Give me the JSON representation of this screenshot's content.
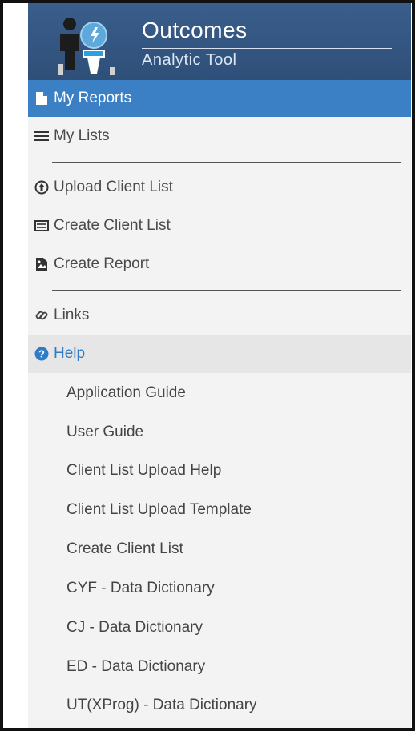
{
  "brand": {
    "title": "Outcomes",
    "subtitle": "Analytic Tool"
  },
  "nav": {
    "my_reports": "My Reports",
    "my_lists": "My Lists",
    "upload_client_list": "Upload Client List",
    "create_client_list": "Create Client List",
    "create_report": "Create Report",
    "links": "Links",
    "help": "Help"
  },
  "help_items": [
    "Application Guide",
    "User Guide",
    "Client List Upload Help",
    "Client List Upload Template",
    "Create Client List",
    "CYF - Data Dictionary",
    "CJ - Data Dictionary",
    "ED - Data Dictionary",
    "UT(XProg) - Data Dictionary"
  ],
  "colors": {
    "header": "#3a5e8c",
    "active": "#3b7fc4",
    "help_text": "#2f7bc6",
    "sidebar_bg": "#f3f3f3"
  },
  "icons": {
    "my_reports": "file-icon",
    "my_lists": "list-icon",
    "upload_client_list": "upload-circle-icon",
    "create_client_list": "keyboard-icon",
    "create_report": "image-file-icon",
    "links": "link-icon",
    "help": "question-circle-icon"
  }
}
